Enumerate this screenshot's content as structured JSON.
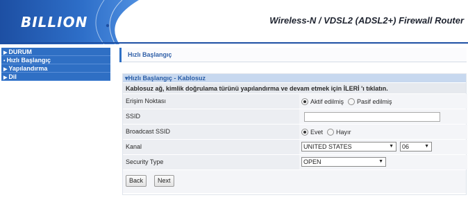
{
  "header": {
    "logo": "BILLION",
    "title": "Wireless-N / VDSL2 (ADSL2+) Firewall Router"
  },
  "sidebar": {
    "items": [
      {
        "label": "DURUM",
        "icon": "triangle-right-icon"
      },
      {
        "label": "Hızlı Başlangıç",
        "icon": "dot-icon"
      },
      {
        "label": "Yapılandırma",
        "icon": "triangle-right-icon"
      },
      {
        "label": "Dil",
        "icon": "triangle-right-icon"
      }
    ]
  },
  "page": {
    "tab_label": "Hızlı Başlangıç"
  },
  "panel": {
    "title": "Hızlı Başlangıç - Kablosuz",
    "description": "Kablosuz ağ, kimlik doğrulama türünü yapılandırma ve devam etmek için İLERİ 'ı tıklatın.",
    "access_point": {
      "label": "Erişim Noktası",
      "options": [
        "Aktif edilmiş",
        "Pasif edilmiş"
      ],
      "selected": "Aktif edilmiş"
    },
    "ssid": {
      "label": "SSID",
      "value": ""
    },
    "broadcast_ssid": {
      "label": "Broadcast SSID",
      "options": [
        "Evet",
        "Hayır"
      ],
      "selected": "Evet"
    },
    "channel": {
      "label": "Kanal",
      "country": "UNITED STATES",
      "number": "06"
    },
    "security_type": {
      "label": "Security Type",
      "value": "OPEN"
    },
    "buttons": {
      "back": "Back",
      "next": "Next"
    }
  },
  "colors": {
    "brand_blue": "#2f6fc4",
    "panel_title_bg": "#c7d8ef",
    "header_text": "#1f2430"
  }
}
